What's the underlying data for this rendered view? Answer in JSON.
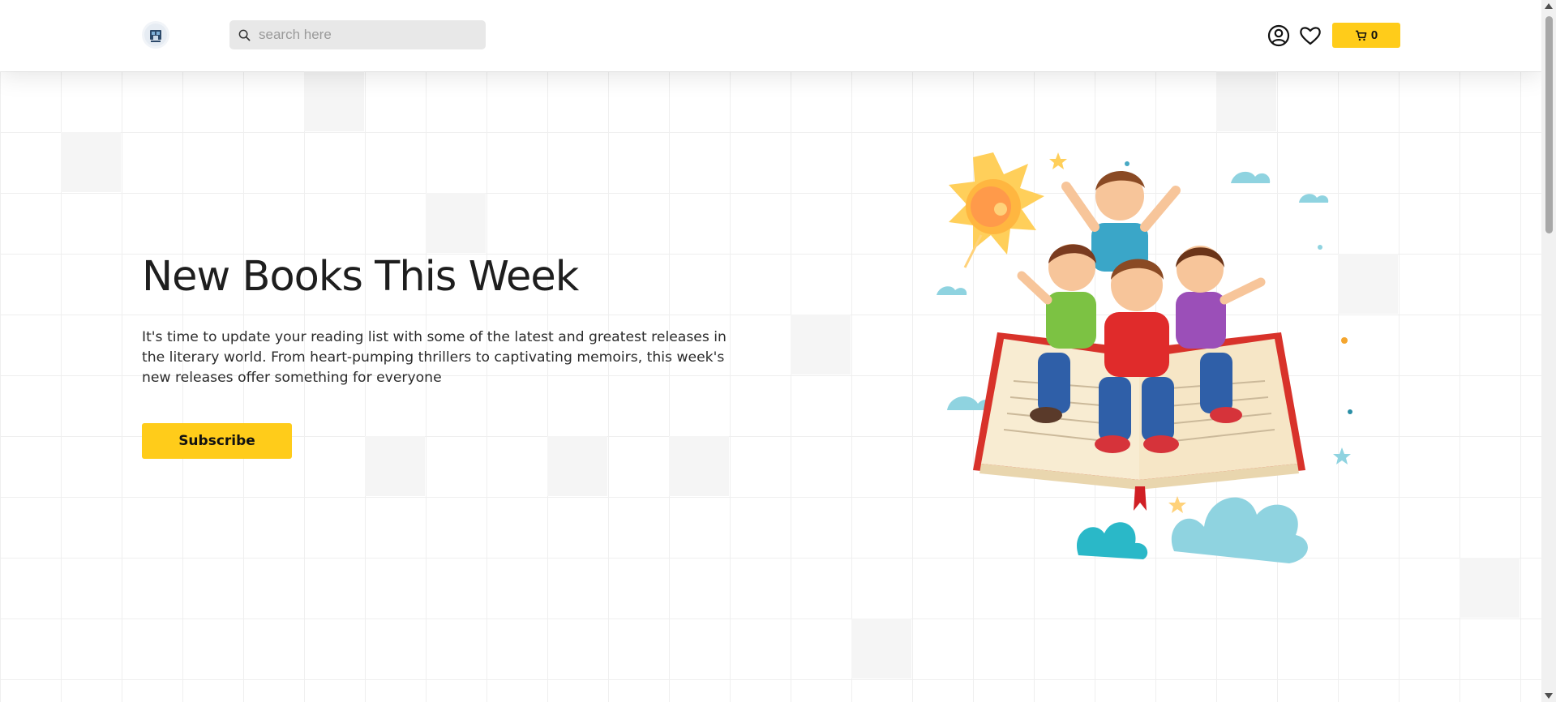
{
  "header": {
    "logo": {
      "icon": "store-logo-icon"
    },
    "search": {
      "placeholder": "search here",
      "value": "",
      "icon": "search-icon"
    },
    "account_icon": "user-circle-icon",
    "wishlist_icon": "heart-icon",
    "cart": {
      "icon": "cart-icon",
      "count": "0"
    }
  },
  "hero": {
    "title": "New Books This Week",
    "description": "It's time to update your reading list with some of the latest and greatest releases in the literary world. From heart-pumping thrillers to captivating memoirs, this week's new releases offer something for everyone",
    "subscribe_label": "Subscribe",
    "illustration": "kids-on-open-book-illustration"
  },
  "colors": {
    "accent": "#ffcc1a",
    "text": "#1e1e1e",
    "search_bg": "#e8e8e8",
    "grid_line": "#efefef"
  }
}
